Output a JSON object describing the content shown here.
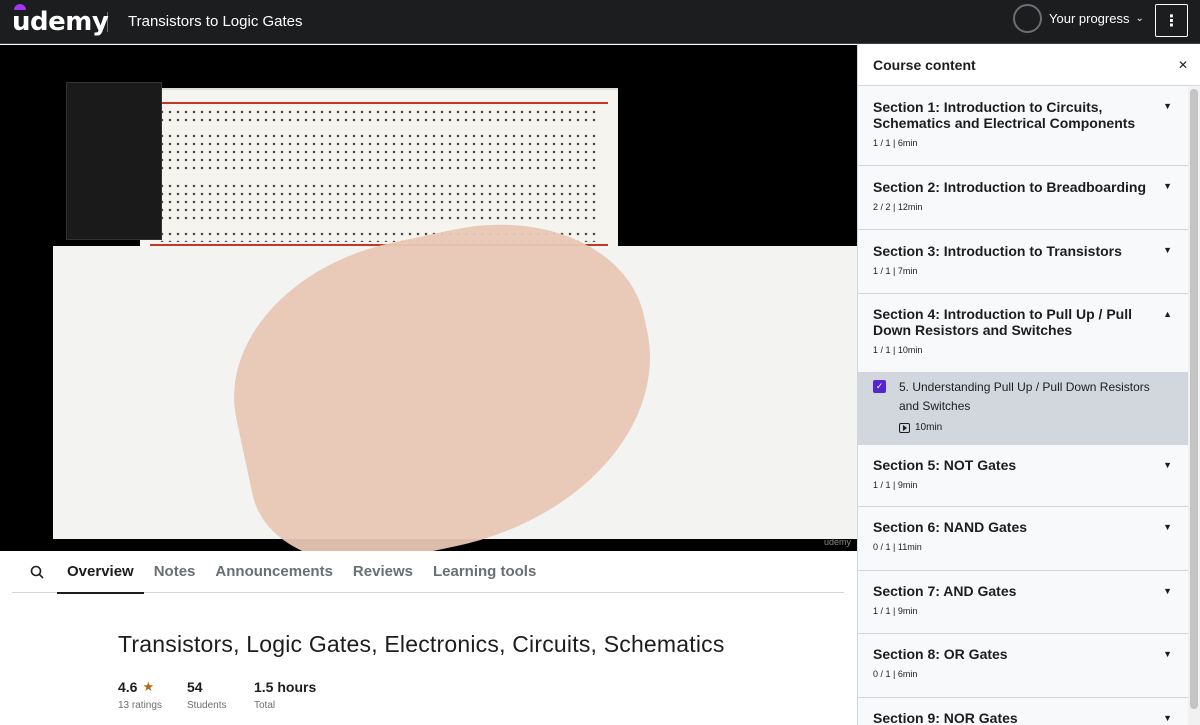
{
  "header": {
    "logo_text": "udemy",
    "course_title": "Transistors to Logic Gates",
    "progress_label": "Your progress",
    "more_icon": "more-vertical-icon"
  },
  "video": {
    "watermark": "udemy"
  },
  "tabs": [
    {
      "label": "Overview",
      "active": true
    },
    {
      "label": "Notes",
      "active": false
    },
    {
      "label": "Announcements",
      "active": false
    },
    {
      "label": "Reviews",
      "active": false
    },
    {
      "label": "Learning tools",
      "active": false
    }
  ],
  "overview": {
    "title": "Transistors, Logic Gates, Electronics, Circuits, Schematics",
    "rating": "4.6",
    "ratings_count": "13 ratings",
    "students": "54",
    "students_label": "Students",
    "hours": "1.5 hours",
    "hours_label": "Total"
  },
  "sidebar": {
    "title": "Course content",
    "sections": [
      {
        "title": "Section 1: Introduction to Circuits, Schematics and Electrical Components",
        "meta": "1 / 1 | 6min",
        "expanded": false
      },
      {
        "title": "Section 2: Introduction to Breadboarding",
        "meta": "2 / 2 | 12min",
        "expanded": false
      },
      {
        "title": "Section 3: Introduction to Transistors",
        "meta": "1 / 1 | 7min",
        "expanded": false
      },
      {
        "title": "Section 4: Introduction to Pull Up / Pull Down Resistors and Switches",
        "meta": "1 / 1 | 10min",
        "expanded": true
      },
      {
        "title": "Section 5: NOT Gates",
        "meta": "1 / 1 | 9min",
        "expanded": false
      },
      {
        "title": "Section 6: NAND Gates",
        "meta": "0 / 1 | 11min",
        "expanded": false
      },
      {
        "title": "Section 7: AND Gates",
        "meta": "1 / 1 | 9min",
        "expanded": false
      },
      {
        "title": "Section 8: OR Gates",
        "meta": "0 / 1 | 6min",
        "expanded": false
      },
      {
        "title": "Section 9: NOR Gates",
        "meta": "",
        "expanded": false
      }
    ],
    "current_lecture": {
      "title": "5. Understanding Pull Up / Pull Down Resistors and Switches",
      "duration": "10min",
      "completed": true
    }
  },
  "colors": {
    "header_bg": "#1c1d1f",
    "accent": "#5624d0",
    "rating": "#b4690e",
    "active_lecture_bg": "#d1d7dc"
  }
}
